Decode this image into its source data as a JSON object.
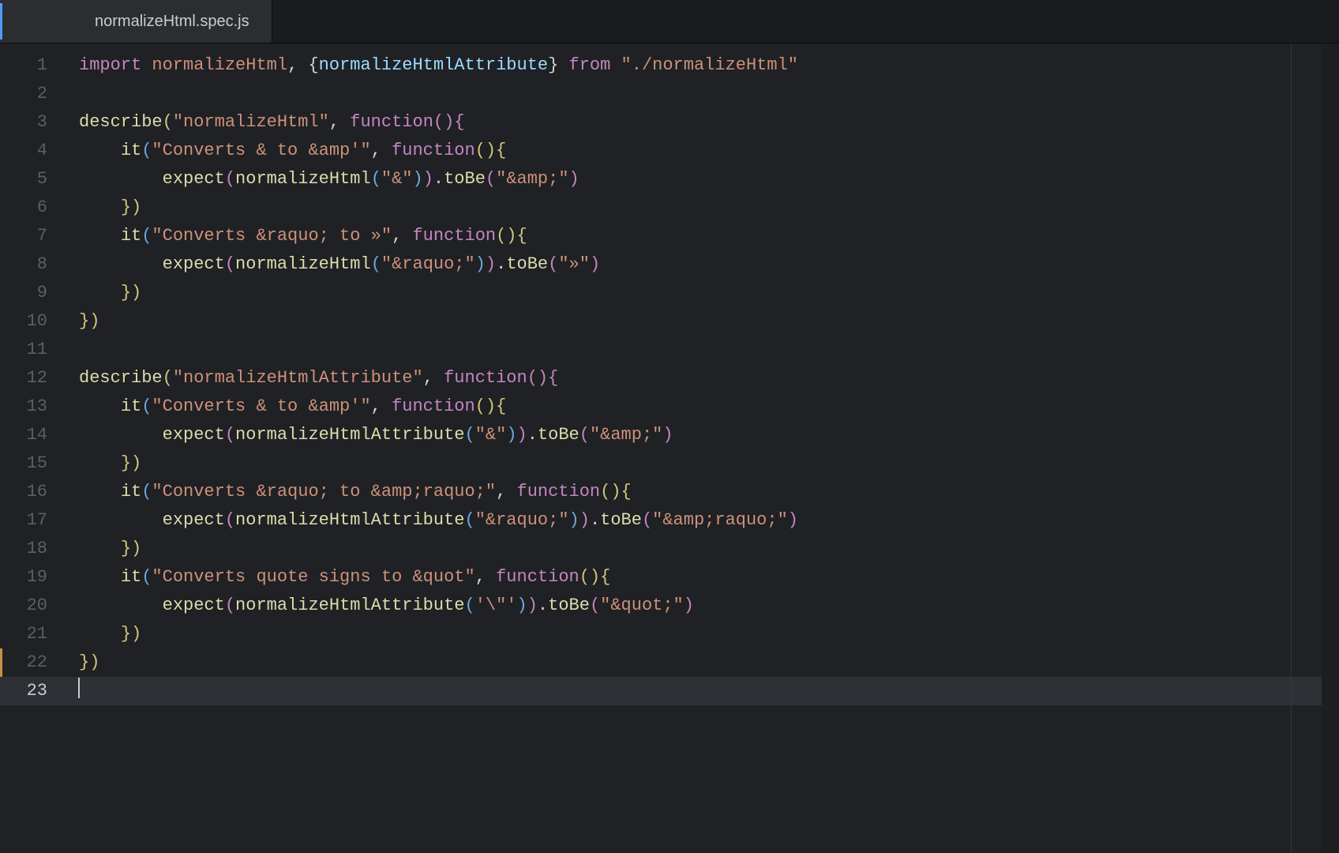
{
  "tab": {
    "filename": "normalizeHtml.spec.js"
  },
  "editor": {
    "lineNumbers": [
      "1",
      "2",
      "3",
      "4",
      "5",
      "6",
      "7",
      "8",
      "9",
      "10",
      "11",
      "12",
      "13",
      "14",
      "15",
      "16",
      "17",
      "18",
      "19",
      "20",
      "21",
      "22",
      "23"
    ],
    "activeLine": 22,
    "modifiedLines": [
      21
    ],
    "code": {
      "l1": {
        "t0": "import ",
        "t1": "normalizeHtml",
        "t2": ", {",
        "t3": "normalizeHtmlAttribute",
        "t4": "} ",
        "t5": "from ",
        "t6": "\"./normalizeHtml\""
      },
      "l3": {
        "t0": "describe",
        "t1": "(",
        "t2": "\"normalizeHtml\"",
        "t3": ", ",
        "t4": "function",
        "t5": "()",
        "t6": "{"
      },
      "l4": {
        "t0": "it",
        "t1": "(",
        "t2": "\"Converts & to &amp'\"",
        "t3": ", ",
        "t4": "function",
        "t5": "()",
        "t6": "{"
      },
      "l5": {
        "t0": "expect",
        "t1": "(",
        "t2": "normalizeHtml",
        "t3": "(",
        "t4": "\"&\"",
        "t5": ")",
        "t6": ")",
        "t7": ".",
        "t8": "toBe",
        "t9": "(",
        "t10": "\"&amp;\"",
        "t11": ")"
      },
      "l6": {
        "t0": "})"
      },
      "l7": {
        "t0": "it",
        "t1": "(",
        "t2": "\"Converts &raquo; to »\"",
        "t3": ", ",
        "t4": "function",
        "t5": "()",
        "t6": "{"
      },
      "l8": {
        "t0": "expect",
        "t1": "(",
        "t2": "normalizeHtml",
        "t3": "(",
        "t4": "\"&raquo;\"",
        "t5": ")",
        "t6": ")",
        "t7": ".",
        "t8": "toBe",
        "t9": "(",
        "t10": "\"»\"",
        "t11": ")"
      },
      "l9": {
        "t0": "})"
      },
      "l10": {
        "t0": "})"
      },
      "l12": {
        "t0": "describe",
        "t1": "(",
        "t2": "\"normalizeHtmlAttribute\"",
        "t3": ", ",
        "t4": "function",
        "t5": "()",
        "t6": "{"
      },
      "l13": {
        "t0": "it",
        "t1": "(",
        "t2": "\"Converts & to &amp'\"",
        "t3": ", ",
        "t4": "function",
        "t5": "()",
        "t6": "{"
      },
      "l14": {
        "t0": "expect",
        "t1": "(",
        "t2": "normalizeHtmlAttribute",
        "t3": "(",
        "t4": "\"&\"",
        "t5": ")",
        "t6": ")",
        "t7": ".",
        "t8": "toBe",
        "t9": "(",
        "t10": "\"&amp;\"",
        "t11": ")"
      },
      "l15": {
        "t0": "})"
      },
      "l16": {
        "t0": "it",
        "t1": "(",
        "t2": "\"Converts &raquo; to &amp;raquo;\"",
        "t3": ", ",
        "t4": "function",
        "t5": "()",
        "t6": "{"
      },
      "l17": {
        "t0": "expect",
        "t1": "(",
        "t2": "normalizeHtmlAttribute",
        "t3": "(",
        "t4": "\"&raquo;\"",
        "t5": ")",
        "t6": ")",
        "t7": ".",
        "t8": "toBe",
        "t9": "(",
        "t10": "\"&amp;raquo;\"",
        "t11": ")"
      },
      "l18": {
        "t0": "})"
      },
      "l19": {
        "t0": "it",
        "t1": "(",
        "t2": "\"Converts quote signs to &quot\"",
        "t3": ", ",
        "t4": "function",
        "t5": "()",
        "t6": "{"
      },
      "l20": {
        "t0": "expect",
        "t1": "(",
        "t2": "normalizeHtmlAttribute",
        "t3": "(",
        "t4": "'\\\"'",
        "t5": ")",
        "t6": ")",
        "t7": ".",
        "t8": "toBe",
        "t9": "(",
        "t10": "\"&quot;\"",
        "t11": ")"
      },
      "l21": {
        "t0": "})"
      },
      "l22": {
        "t0": "})"
      }
    }
  }
}
